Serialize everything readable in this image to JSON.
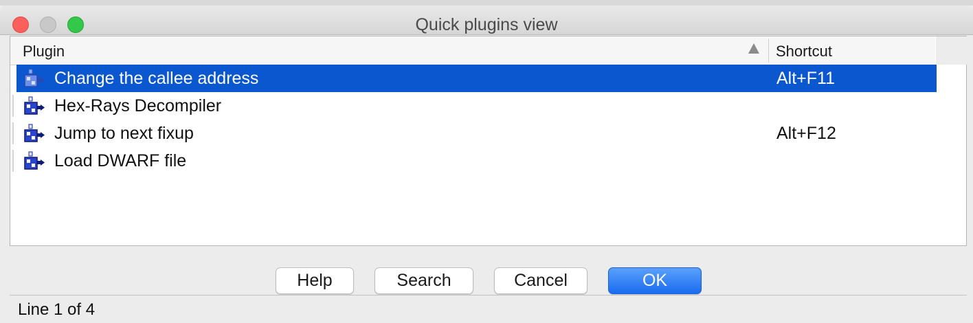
{
  "window": {
    "title": "Quick plugins view"
  },
  "table": {
    "columns": {
      "plugin": "Plugin",
      "shortcut": "Shortcut"
    },
    "sort": "ascending",
    "rows": [
      {
        "name": "Change the callee address",
        "shortcut": "Alt+F11",
        "selected": true,
        "icon": "plugin-icon"
      },
      {
        "name": "Hex-Rays Decompiler",
        "shortcut": "",
        "selected": false,
        "icon": "plugin-icon"
      },
      {
        "name": "Jump to next fixup",
        "shortcut": "Alt+F12",
        "selected": false,
        "icon": "plugin-icon"
      },
      {
        "name": "Load DWARF file",
        "shortcut": "",
        "selected": false,
        "icon": "plugin-icon"
      }
    ]
  },
  "buttons": {
    "help": "Help",
    "search": "Search",
    "cancel": "Cancel",
    "ok": "OK"
  },
  "status": {
    "text": "Line 1 of 4"
  },
  "colors": {
    "selection": "#0b57d0",
    "ok_button": "#1a6cf0",
    "close": "#fc605c",
    "maximize": "#34c84a"
  }
}
